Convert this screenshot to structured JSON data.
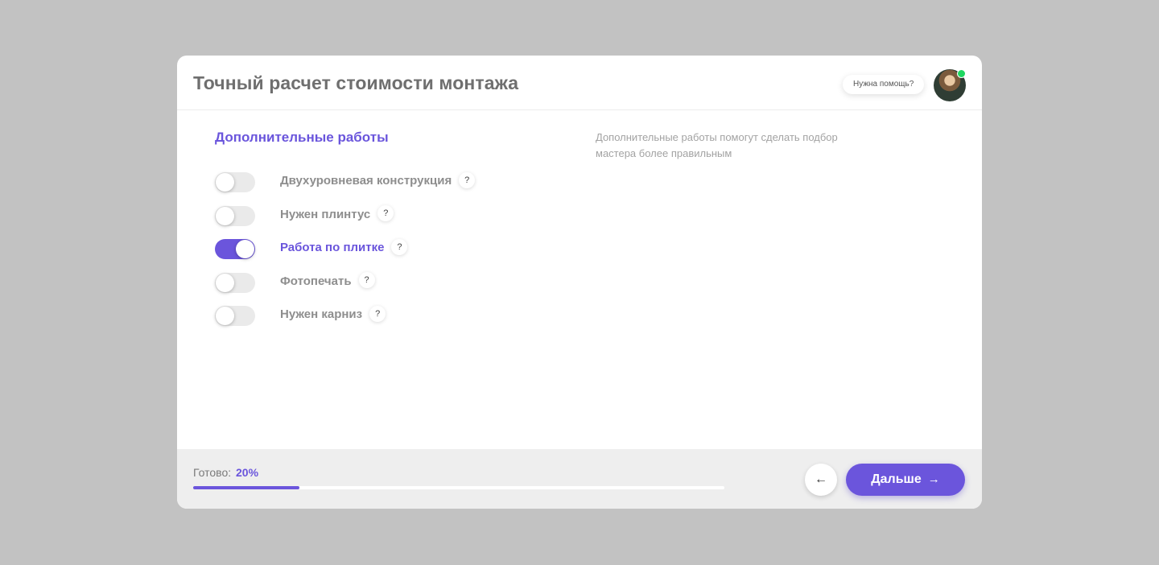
{
  "header": {
    "title": "Точный расчет стоимости монтажа",
    "help_text": "Нужна помощь?"
  },
  "section": {
    "title": "Дополнительные работы",
    "hint": "Дополнительные работы помогут сделать подбор мастера более правильным"
  },
  "options": [
    {
      "label": "Двухуровневая конструкция",
      "enabled": false,
      "help": "?"
    },
    {
      "label": "Нужен плинтус",
      "enabled": false,
      "help": "?"
    },
    {
      "label": "Работа по плитке",
      "enabled": true,
      "help": "?"
    },
    {
      "label": "Фотопечать",
      "enabled": false,
      "help": "?"
    },
    {
      "label": "Нужен карниз",
      "enabled": false,
      "help": "?"
    }
  ],
  "footer": {
    "progress_label": "Готово:",
    "progress_text": "20%",
    "progress_value": 0.2,
    "back_icon": "←",
    "next_label": "Дальше",
    "next_icon": "→"
  },
  "colors": {
    "accent": "#6b55dc",
    "online": "#1ed760",
    "backdrop": "#c2c2c2"
  }
}
